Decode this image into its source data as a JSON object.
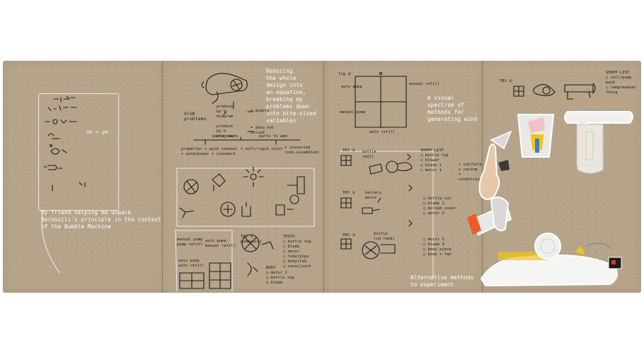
{
  "pages": [
    {
      "id": "page-1",
      "formula": "∂V + ρV",
      "caption": "My friend helping me unpack\nBernoulli's principle in the context\nof the Bubble Machine"
    },
    {
      "id": "page-2",
      "intro": "Reducing\nthe whole\ndesign into\nan equation,\nbreaking my\nproblems down\ninto bite-sized\nvariables",
      "equation_left": "V+IR\nproblems",
      "equation_terms": [
        "produce\nby V\ndiagram",
        "= models",
        "produce\nby V\ndiagram",
        "= data not\nsolved"
      ],
      "category_left": "parts needs",
      "category_right": "parts to add",
      "sub_left": "propeller + wind channel\n+ wind/power + standard",
      "sub_mid": "+ soft/rigid joint",
      "sub_right": "+ connected\n(non-assembled)",
      "bottom_labels": [
        "manual pump\npump refill",
        "auto pump\nmanual refill",
        "auto pump\nauto refill"
      ],
      "try_label": "TRY ①\npump+wifi",
      "list_tests": "TESTS\n○ bottle top\n○ blade\n○ motor\n○ tube/pipe\n○ body+fan\n○ case/joint",
      "list_bottom": "BODY\n○ motor 2\n○ bottle top\n○ blade"
    },
    {
      "id": "page-3",
      "grid_label": "fig ②",
      "grid_axes": [
        "auto pump",
        "manual refill",
        "manual pump",
        "auto refill"
      ],
      "note": "A visual\nspectrum of\nmethods for\ngenerating wind",
      "trials": [
        {
          "label": "TRY ①",
          "sub": "bottle\nshell",
          "list": "SHOPP LIST\n○ bottle top\n○ blower\n○ blade 1\n○ motor 1"
        },
        {
          "label": "TRY ②",
          "sub": "battery\nmotor",
          "list": "○ bottle cut\n○ blade 2\n○ bolted cover\n○ motor 2"
        },
        {
          "label": "TRY ③",
          "sub": "bottle\nlid (mod)",
          "list": "○ motor 3\n○ blade 3\n○ body piece\n○ body + fan"
        }
      ],
      "extra": "+ cut/hole\n+ casing\n+ conditional",
      "caption": "Alternative methods\nto experiment"
    },
    {
      "id": "page-4",
      "try_label": "TRY ①",
      "list": "SHOPP LIST\n○ cell/pump pack\n○ lamp/manual thing"
    }
  ],
  "colors": {
    "paper": "#b5a48a",
    "ink": "#1f1b17",
    "chalk": "#ffffff",
    "accent_orange": "#f05a28",
    "accent_blue": "#3b7fc4",
    "accent_yellow": "#f2c418"
  }
}
